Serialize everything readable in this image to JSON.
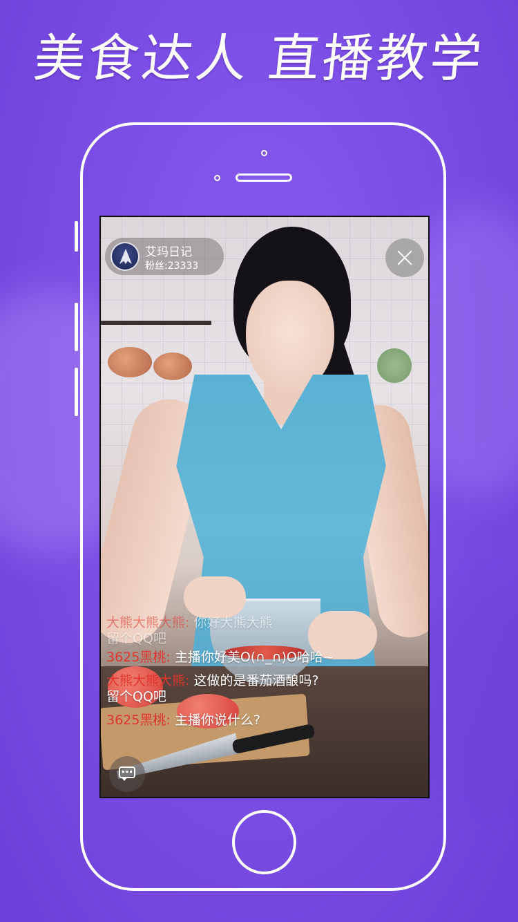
{
  "headline": "美食达人 直播教学",
  "stream": {
    "host": {
      "name": "艾玛日记",
      "fans_label": "粉丝:23333"
    },
    "close_icon": "close-icon",
    "comment_icon": "chat-icon",
    "chat": [
      {
        "user": "大熊大熊大熊:",
        "message": "你好大熊大熊",
        "second_line": "留个QQ吧",
        "faded": true
      },
      {
        "user": "3625黑桃:",
        "message": "主播你好美O(∩_∩)O哈哈~"
      },
      {
        "user": "大熊大熊大熊:",
        "message": "这做的是番茄酒酿吗?",
        "second_line": "留个QQ吧"
      },
      {
        "user": "3625黑桃:",
        "message": "主播你说什么?"
      }
    ]
  },
  "colors": {
    "background": "#7c4fe6",
    "chat_user": "#e0352d",
    "dress": "#5bb1d3"
  }
}
